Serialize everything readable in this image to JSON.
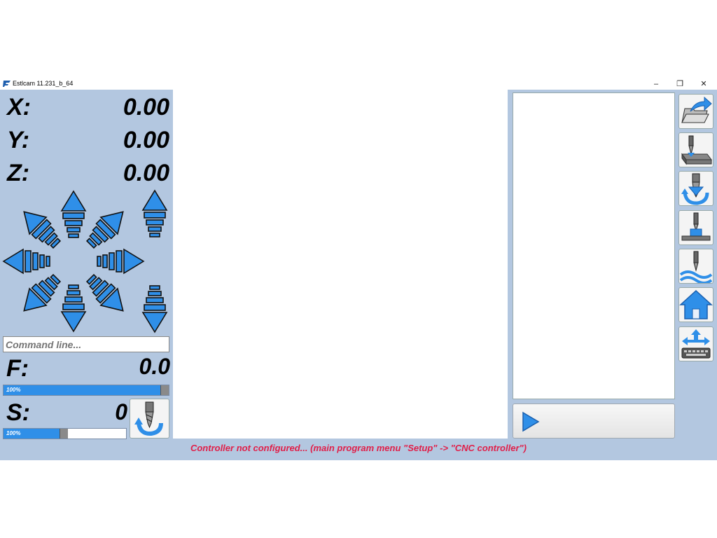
{
  "window": {
    "title": "Estlcam 11.231_b_64"
  },
  "axes": [
    {
      "label": "X:",
      "value": "0.00"
    },
    {
      "label": "Y:",
      "value": "0.00"
    },
    {
      "label": "Z:",
      "value": "0.00"
    }
  ],
  "command_line": {
    "placeholder": "Command line..."
  },
  "feed": {
    "label": "F:",
    "value": "0.0",
    "override_text": "100%",
    "override_percent": 100
  },
  "spindle": {
    "label": "S:",
    "value": "0",
    "override_text": "100%",
    "override_percent": 45
  },
  "toolbar": {
    "icons": [
      "open-file-icon",
      "tool-length-probe-icon",
      "tool-change-icon",
      "zero-workpiece-icon",
      "height-map-icon",
      "home-icon",
      "keyboard-jog-icon"
    ]
  },
  "status": {
    "message": "Controller not configured... (main program menu \"Setup\" -> \"CNC controller\")"
  },
  "colors": {
    "panel": "#b3c7e0",
    "accent": "#2f8fe8",
    "status": "#e0204a"
  }
}
